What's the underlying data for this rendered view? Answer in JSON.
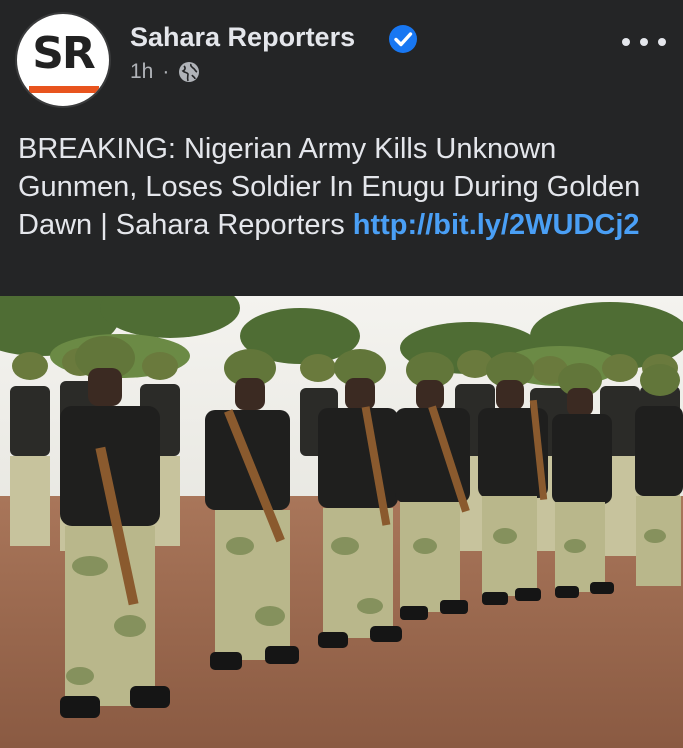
{
  "page": {
    "name": "Sahara Reporters",
    "avatar_text": "SR",
    "time": "1h",
    "separator": "·"
  },
  "post": {
    "text": "BREAKING: Nigerian Army Kills Unknown Gunmen, Loses Soldier In Enugu During Golden Dawn | Sahara Reporters ",
    "link": "http://bit.ly/2WUDCj2"
  },
  "icons": {
    "verified": "verified-badge-icon",
    "audience": "globe-icon",
    "more": "more-options-icon"
  },
  "colors": {
    "background": "#242526",
    "link": "#4a9ff5",
    "verified": "#1877f2",
    "logo_bar": "#e8541e"
  }
}
